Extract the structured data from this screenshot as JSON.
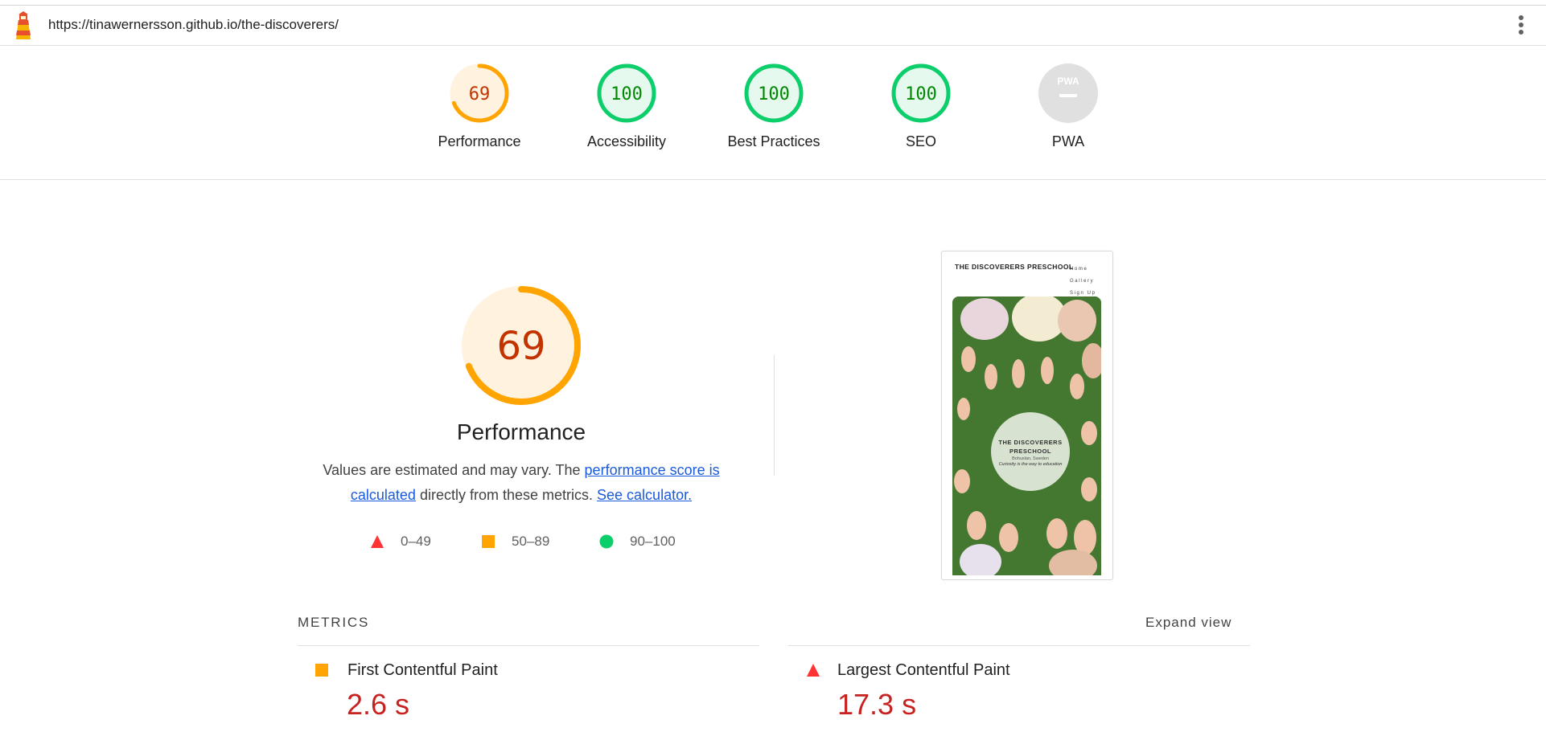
{
  "url_bar": {
    "url": "https://tinawernersson.github.io/the-discoverers/"
  },
  "colors": {
    "fail": "#f33",
    "average": "#ffa400",
    "pass": "#0cce6b",
    "average_text": "#c33300",
    "pass_text": "#008800",
    "fail_text": "#c7221f",
    "link": "#1a5adb"
  },
  "scores": [
    {
      "label": "Performance",
      "score": "69",
      "score_fraction": 0.69,
      "status": "average"
    },
    {
      "label": "Accessibility",
      "score": "100",
      "score_fraction": 1.0,
      "status": "pass"
    },
    {
      "label": "Best Practices",
      "score": "100",
      "score_fraction": 1.0,
      "status": "pass"
    },
    {
      "label": "SEO",
      "score": "100",
      "score_fraction": 1.0,
      "status": "pass"
    },
    {
      "label": "PWA",
      "badge": "PWA",
      "status": "na"
    }
  ],
  "performance": {
    "score": "69",
    "score_fraction": 0.69,
    "title": "Performance",
    "desc_prefix": "Values are estimated and may vary. The ",
    "link_score": "performance score is calculated",
    "desc_middle": " directly from these metrics. ",
    "link_calc": "See calculator."
  },
  "legend": [
    {
      "range": "0–49",
      "icon": "triangle-icon",
      "color": "#f33"
    },
    {
      "range": "50–89",
      "icon": "square-icon",
      "color": "#ffa400"
    },
    {
      "range": "90–100",
      "icon": "circle-icon",
      "color": "#0cce6b"
    }
  ],
  "screenshot": {
    "title": "THE DISCOVERERS PRESCHOOL",
    "nav": [
      "Home",
      "Gallery",
      "Sign Up"
    ],
    "circle_title": "THE DISCOVERERS PRESCHOOL",
    "circle_location": "Bohuslan, Sweden",
    "circle_tagline": "Curiosity is the way to education"
  },
  "metrics": {
    "header": "METRICS",
    "expand_label": "Expand view",
    "items": [
      {
        "name": "First Contentful Paint",
        "value": "2.6 s",
        "status": "average",
        "icon": "square-icon"
      },
      {
        "name": "Largest Contentful Paint",
        "value": "17.3 s",
        "status": "fail",
        "icon": "triangle-icon"
      }
    ]
  }
}
